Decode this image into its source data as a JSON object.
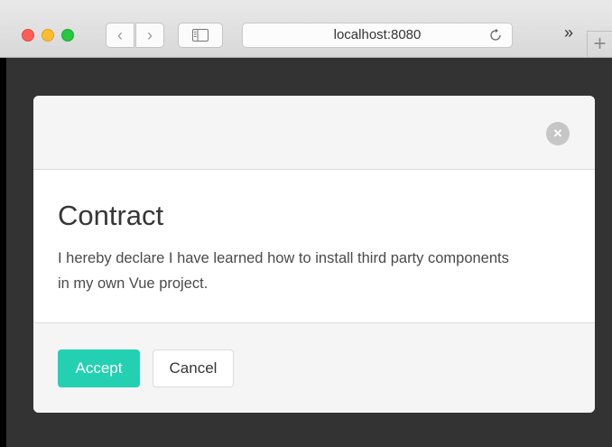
{
  "browser": {
    "address": "localhost:8080",
    "back_icon": "‹",
    "forward_icon": "›",
    "overflow_icon": "»",
    "new_tab_icon": "+"
  },
  "modal": {
    "title": "Contract",
    "body": "I hereby declare I have learned how to install third party components in my own Vue project.",
    "close_icon": "×",
    "accept_label": "Accept",
    "cancel_label": "Cancel"
  },
  "colors": {
    "accent": "#23d1b2",
    "backdrop": "#333333",
    "modal_bg": "#ffffff",
    "header_footer_bg": "#f5f5f5"
  }
}
